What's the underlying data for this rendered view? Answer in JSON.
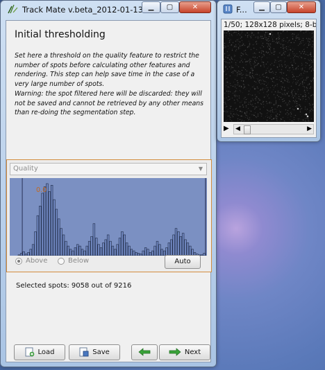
{
  "main_window": {
    "title": "Track Mate v.beta_2012-01-13",
    "heading": "Initial thresholding",
    "description_lines": [
      "Set here a threshold on the quality feature to restrict the",
      "number of spots before calculating other features and",
      "rendering. This step can help save time in the case of a",
      "very large number of spots.",
      "Warning: the spot filtered here will be discarded: they will",
      "not be saved and cannot be retrieved by any other means",
      "than re-doing the segmentation step."
    ],
    "feature_select": "Quality",
    "threshold_value": "0.0",
    "radio_above": "Above",
    "radio_below": "Below",
    "auto_button": "Auto",
    "selected_spots": "Selected spots: 9058 out of 9216",
    "buttons": {
      "load": "Load",
      "save": "Save",
      "next": "Next"
    }
  },
  "image_window": {
    "title": "F...",
    "info": "1/50; 128x128 pixels; 8-b"
  },
  "colors": {
    "histogram_bg": "#7b90c2",
    "histogram_selected": "#6f86bf",
    "panel_border": "#d28b3c",
    "threshold_label": "#c4691e"
  },
  "chart_data": {
    "type": "bar",
    "values": [
      1,
      3,
      5,
      2,
      4,
      8,
      14,
      30,
      50,
      62,
      78,
      86,
      90,
      80,
      88,
      70,
      58,
      46,
      34,
      26,
      18,
      12,
      8,
      6,
      10,
      14,
      12,
      8,
      6,
      12,
      18,
      24,
      40,
      22,
      14,
      10,
      16,
      20,
      26,
      18,
      12,
      8,
      14,
      22,
      30,
      26,
      16,
      12,
      8,
      6,
      4,
      3,
      2,
      6,
      10,
      8,
      4,
      6,
      12,
      18,
      14,
      8,
      6,
      10,
      16,
      20,
      26,
      34,
      30,
      24,
      28,
      20,
      16,
      12,
      8,
      4,
      2,
      1,
      1,
      3
    ],
    "selected_from_index": 1,
    "threshold": 0.0
  }
}
